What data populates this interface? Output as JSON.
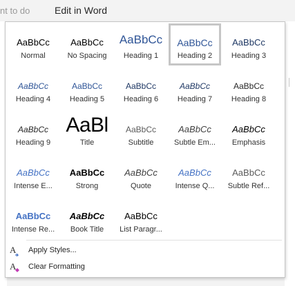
{
  "topbar": {
    "faded_text": "nt to do",
    "edit_label": "Edit in Word"
  },
  "styles": [
    {
      "preview": "AaBbCc",
      "name": "Normal"
    },
    {
      "preview": "AaBbCc",
      "name": "No Spacing"
    },
    {
      "preview": "AaBbCc",
      "name": "Heading 1"
    },
    {
      "preview": "AaBbCc",
      "name": "Heading 2",
      "selected": true
    },
    {
      "preview": "AaBbCc",
      "name": "Heading 3"
    },
    {
      "preview": "AaBbCc",
      "name": "Heading 4"
    },
    {
      "preview": "AaBbCc",
      "name": "Heading 5"
    },
    {
      "preview": "AaBbCc",
      "name": "Heading 6"
    },
    {
      "preview": "AaBbCc",
      "name": "Heading 7"
    },
    {
      "preview": "AaBbCc",
      "name": "Heading 8"
    },
    {
      "preview": "AaBbCc",
      "name": "Heading 9"
    },
    {
      "preview": "AaBl",
      "name": "Title"
    },
    {
      "preview": "AaBbCc",
      "name": "Subtitle"
    },
    {
      "preview": "AaBbCc",
      "name": "Subtle Em..."
    },
    {
      "preview": "AaBbCc",
      "name": "Emphasis"
    },
    {
      "preview": "AaBbCc",
      "name": "Intense E..."
    },
    {
      "preview": "AaBbCc",
      "name": "Strong"
    },
    {
      "preview": "AaBbCc",
      "name": "Quote"
    },
    {
      "preview": "AaBbCc",
      "name": "Intense Q..."
    },
    {
      "preview": "AaBbCc",
      "name": "Subtle Ref..."
    },
    {
      "preview": "AaBbCc",
      "name": "Intense Re..."
    },
    {
      "preview": "AaBbCc",
      "name": "Book Title"
    },
    {
      "preview": "AaBbCc",
      "name": "List Paragr..."
    }
  ],
  "commands": {
    "apply_styles": "Apply Styles...",
    "clear_formatting": "Clear Formatting"
  },
  "icons": {
    "apply_styles": "apply-styles-icon",
    "clear_formatting": "clear-formatting-icon"
  },
  "colors": {
    "heading_blue": "#2f5597",
    "dark_blue": "#1f3864",
    "accent_blue": "#4472c4",
    "selection_border": "#c6c6c6",
    "eraser_pink": "#c239b3"
  }
}
